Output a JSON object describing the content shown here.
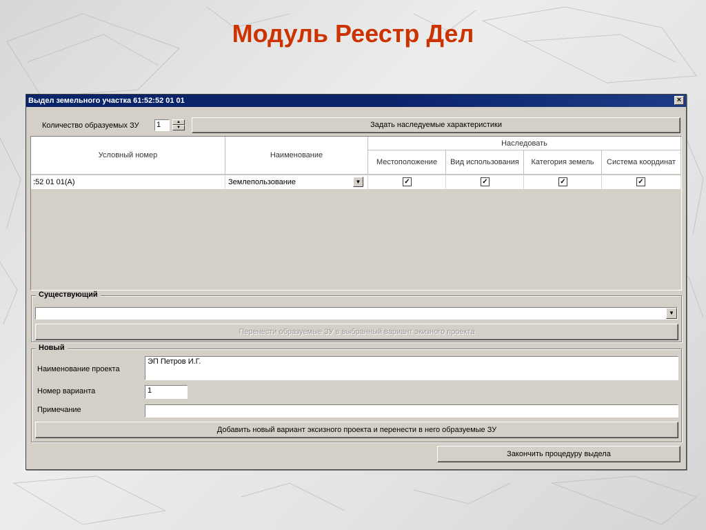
{
  "slide": {
    "title": "Модуль Реестр Дел",
    "title_color": "#cc3300"
  },
  "window": {
    "title": "Выдел земельного участка 61:52:52 01 01",
    "close_glyph": "×"
  },
  "top": {
    "count_label": "Количество образуемых ЗУ",
    "count_value": "1",
    "inherit_button": "Задать наследуемые характеристики"
  },
  "grid": {
    "headers": {
      "number": "Условный номер",
      "name": "Наименование",
      "inherit_group": "Наследовать",
      "location": "Местоположение",
      "use": "Вид использования",
      "category": "Категория земель",
      "coords": "Система координат"
    },
    "rows": [
      {
        "number": ":52 01 01(А)",
        "name": "Землепользование",
        "location": true,
        "use": true,
        "category": true,
        "coords": true
      }
    ]
  },
  "existing": {
    "group_title": "Существующий",
    "select_value": "",
    "transfer_button": "Перенести образуемые ЗУ в выбранный вариант экизного проекта"
  },
  "new": {
    "group_title": "Новый",
    "project_name_label": "Наименование проекта",
    "project_name_value": "ЭП Петров И.Г.",
    "variant_label": "Номер варианта",
    "variant_value": "1",
    "note_label": "Примечание",
    "note_value": "",
    "add_button": "Добавить новый вариант эксизного проекта и перенести в него образуемые ЗУ"
  },
  "finish_button": "Закончить процедуру выдела"
}
